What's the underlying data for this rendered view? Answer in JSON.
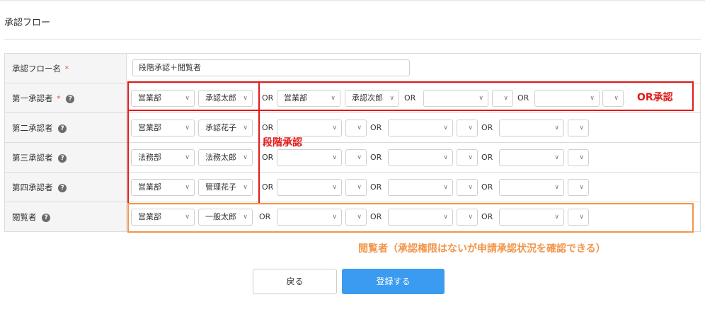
{
  "page": {
    "section_title": "承認フロー"
  },
  "form": {
    "name_row": {
      "label": "承認フロー名",
      "required_mark": "*",
      "value": "段階承認＋閲覧者"
    },
    "rows": [
      {
        "label": "第一承認者",
        "required_mark": "*",
        "groups": [
          {
            "dept": "営業部",
            "person": "承認太郎"
          },
          {
            "dept": "営業部",
            "person": "承認次郎"
          },
          {
            "dept": "",
            "person": ""
          },
          {
            "dept": "",
            "person": ""
          }
        ]
      },
      {
        "label": "第二承認者",
        "groups": [
          {
            "dept": "営業部",
            "person": "承認花子"
          },
          {
            "dept": "",
            "person": ""
          },
          {
            "dept": "",
            "person": ""
          },
          {
            "dept": "",
            "person": ""
          }
        ]
      },
      {
        "label": "第三承認者",
        "groups": [
          {
            "dept": "法務部",
            "person": "法務太郎"
          },
          {
            "dept": "",
            "person": ""
          },
          {
            "dept": "",
            "person": ""
          },
          {
            "dept": "",
            "person": ""
          }
        ]
      },
      {
        "label": "第四承認者",
        "groups": [
          {
            "dept": "営業部",
            "person": "管理花子"
          },
          {
            "dept": "",
            "person": ""
          },
          {
            "dept": "",
            "person": ""
          },
          {
            "dept": "",
            "person": ""
          }
        ]
      },
      {
        "label": "閲覧者",
        "groups": [
          {
            "dept": "営業部",
            "person": "一般太郎"
          },
          {
            "dept": "",
            "person": ""
          },
          {
            "dept": "",
            "person": ""
          },
          {
            "dept": "",
            "person": ""
          }
        ]
      }
    ],
    "or_label": "OR"
  },
  "annotations": {
    "or_approval": "OR承認",
    "stage_approval": "段階承認",
    "viewer_note": "閲覧者（承認権限はないが申請承認状況を確認できる）",
    "colors": {
      "red": "#e21a1a",
      "orange": "#f2954a"
    }
  },
  "buttons": {
    "back": "戻る",
    "submit": "登録する"
  },
  "colors": {
    "primary": "#3a9bf0",
    "label_bg": "#f5f5f5",
    "required": "#e74c3c"
  }
}
